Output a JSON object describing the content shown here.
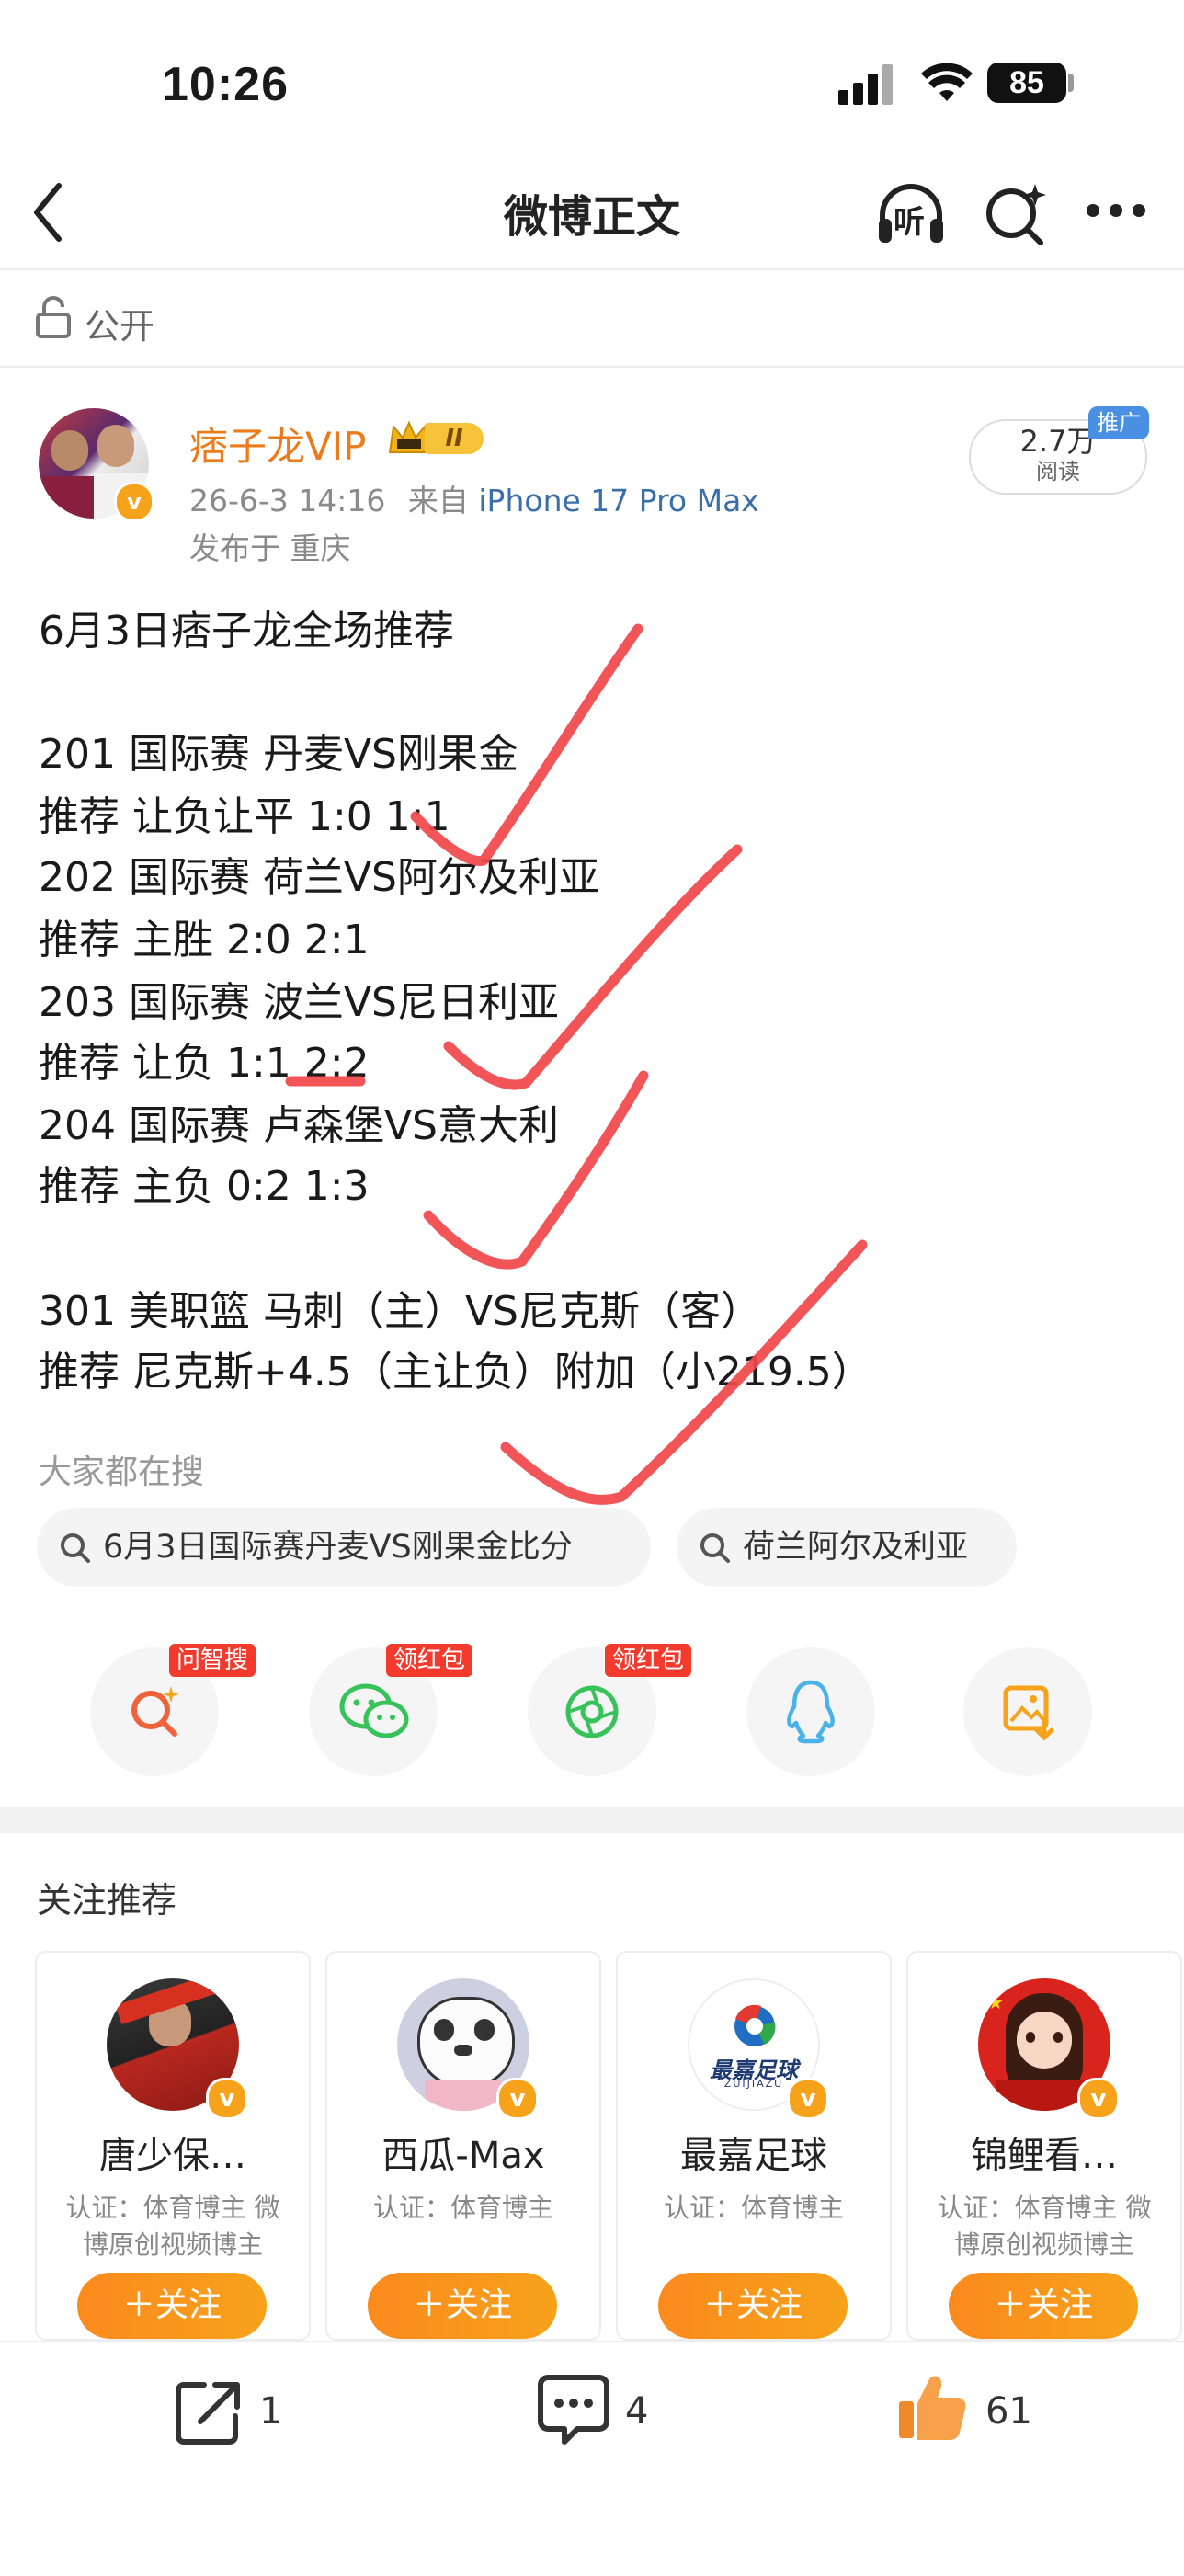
{
  "status_bar": {
    "time": "10:26",
    "battery": "85"
  },
  "nav": {
    "title": "微博正文",
    "listen_label": "听"
  },
  "visibility": {
    "label": "公开"
  },
  "author": {
    "name": "痞子龙VIP",
    "level_badge": "II",
    "post_date": "26-6-3 14:16",
    "source_prefix": "来自",
    "device": "iPhone 17 Pro Max",
    "location": "发布于 重庆",
    "reads_count": "2.7万",
    "reads_label": "阅读",
    "promo_label": "推广"
  },
  "post": {
    "lines": [
      "6月3日痞子龙全场推荐",
      "201 国际赛 丹麦VS刚果金",
      "推荐 让负让平 1:0 1:1",
      "202 国际赛 荷兰VS阿尔及利亚",
      "推荐 主胜 2:0 2:1",
      "203 国际赛 波兰VS尼日利亚",
      "推荐 让负 1:1 2:2",
      "204 国际赛 卢森堡VS意大利",
      "推荐 主负 0:2 1:3",
      "301 美职篮 马刺（主）VS尼克斯（客）",
      "推荐 尼克斯+4.5（主让负）附加（小219.5）"
    ]
  },
  "hot_search": {
    "title": "大家都在搜",
    "chips": [
      "6月3日国际赛丹麦VS刚果金比分",
      "荷兰阿尔及利亚"
    ]
  },
  "share_row": {
    "items": [
      {
        "icon": "ask-search-icon",
        "tag": "问智搜",
        "color": "#f0623a"
      },
      {
        "icon": "wechat-icon",
        "tag": "领红包",
        "color": "#37c25a"
      },
      {
        "icon": "moments-icon",
        "tag": "领红包",
        "color": "#37c25a"
      },
      {
        "icon": "qq-icon",
        "tag": "",
        "color": "#4ab2e8"
      },
      {
        "icon": "save-image-icon",
        "tag": "",
        "color": "#f7a21b"
      }
    ]
  },
  "recommend": {
    "title": "关注推荐",
    "follow_label": "＋关注",
    "cards": [
      {
        "name": "唐少保…",
        "auth": "认证：体育博主 微博原创视频博主"
      },
      {
        "name": "西瓜-Max",
        "auth": "认证：体育博主"
      },
      {
        "name": "最嘉足球",
        "auth": "认证：体育博主",
        "logo_text": "最嘉足球",
        "logo_sub": "ZUIJIAZU"
      },
      {
        "name": "锦鲤看…",
        "auth": "认证：体育博主 微博原创视频博主"
      }
    ]
  },
  "bottom_bar": {
    "share_count": "1",
    "comment_count": "4",
    "like_count": "61"
  }
}
